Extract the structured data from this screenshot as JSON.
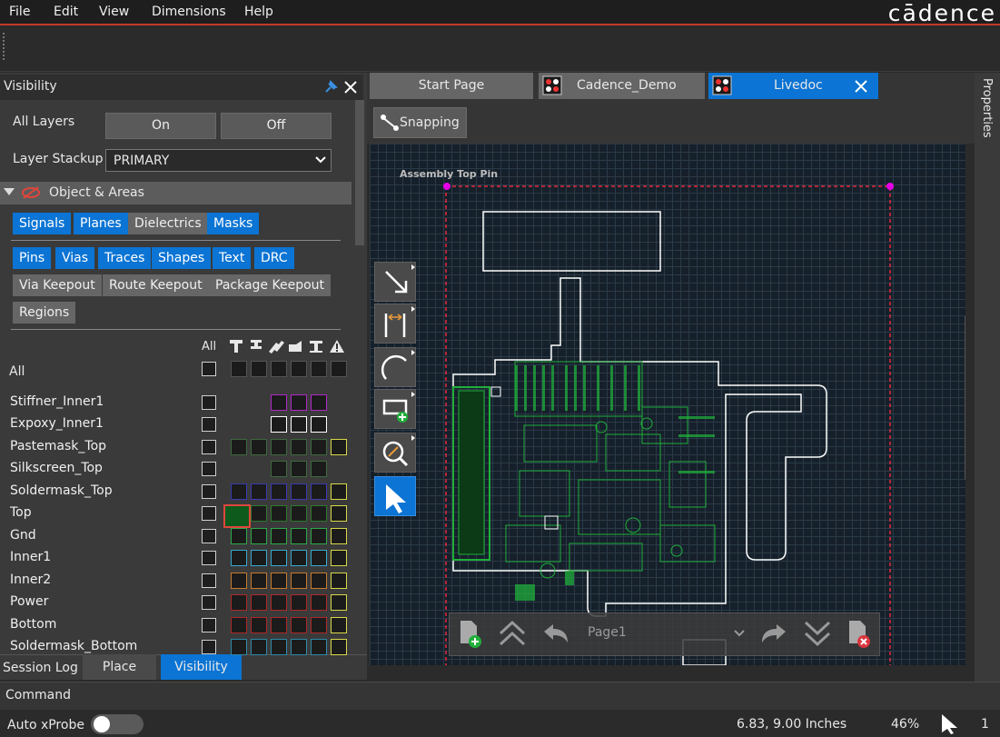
{
  "menu": {
    "items": [
      "File",
      "Edit",
      "View",
      "Dimensions",
      "Help"
    ],
    "logo": "cādence"
  },
  "visibility_panel": {
    "title": "Visibility",
    "all_layers_label": "All Layers",
    "on_label": "On",
    "off_label": "Off",
    "layer_stackup_label": "Layer Stackup",
    "layer_stackup_value": "PRIMARY",
    "section_label": "Object & Areas",
    "group1": [
      "Signals",
      "Planes",
      "Dielectrics",
      "Masks"
    ],
    "group1_state": [
      "on",
      "on",
      "off",
      "on"
    ],
    "group2": [
      "Pins",
      "Vias",
      "Traces",
      "Shapes",
      "Text",
      "DRC"
    ],
    "group3": [
      "Via Keepout",
      "Route Keepout",
      "Package Keepout"
    ],
    "group4": [
      "Regions"
    ],
    "all_col_label": "All",
    "all_row_label": "All",
    "layers": [
      "Stiffner_Inner1",
      "Expoxy_Inner1",
      "Pastemask_Top",
      "Silkscreen_Top",
      "Soldermask_Top",
      "Top",
      "Gnd",
      "Inner1",
      "Inner2",
      "Power",
      "Bottom",
      "Soldermask_Bottom"
    ]
  },
  "bottom_tabs": {
    "session_log": "Session Log",
    "place": "Place",
    "visibility": "Visibility"
  },
  "command_label": "Command",
  "doc_tabs": {
    "start": "Start Page",
    "demo": "Cadence_Demo",
    "livedoc": "Livedoc"
  },
  "snapping_label": "Snapping",
  "canvas": {
    "assembly_label": "Assembly Top Pin",
    "page_label": "Page1"
  },
  "properties_label": "Properties",
  "status": {
    "auto_xprobe": "Auto xProbe",
    "coords": "6.83, 9.00 Inches",
    "zoom": "46%",
    "count": "1"
  },
  "colors": {
    "accent": "#0b74d4",
    "brand_red": "#c0392b",
    "trace_green": "#1fae3a",
    "magenta": "#e600e6"
  }
}
